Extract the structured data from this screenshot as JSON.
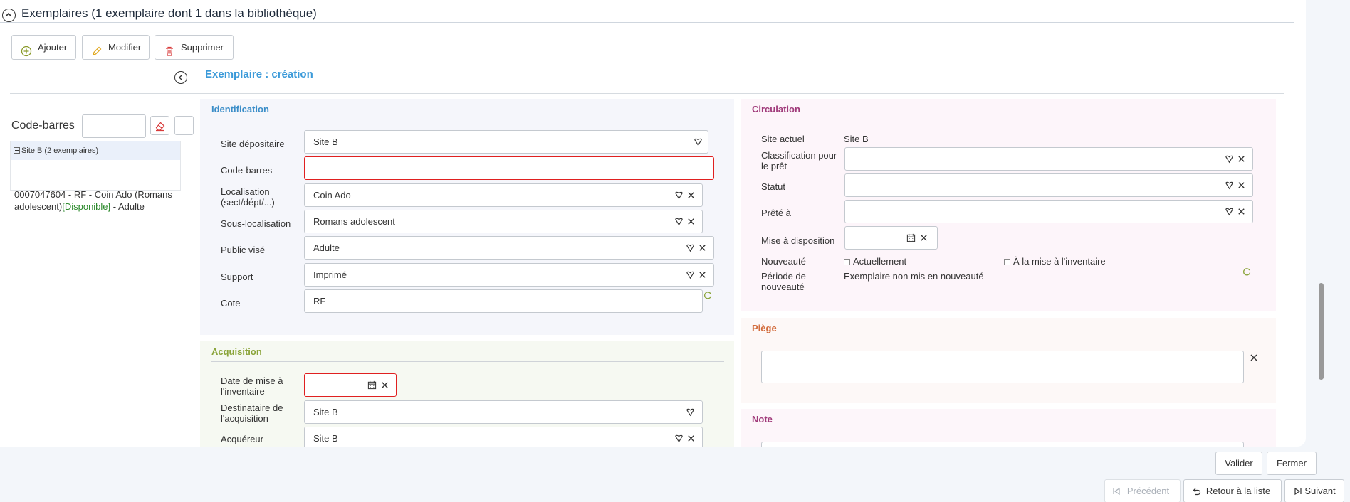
{
  "header": {
    "title": "Exemplaires (1 exemplaire dont 1 dans la bibliothèque)"
  },
  "toolbar": {
    "add": "Ajouter",
    "edit": "Modifier",
    "delete": "Supprimer"
  },
  "form": {
    "title": "Exemplaire : création"
  },
  "barcode_search": {
    "label": "Code-barres",
    "value": ""
  },
  "tree": {
    "node": "Site B (2 exemplaires)",
    "item_text": "0007047604 - RF - Coin Ado (Romans adolescent)",
    "item_status": "[Disponible]",
    "item_tail": " - Adulte"
  },
  "identification": {
    "title": "Identification",
    "fields": {
      "site": {
        "label": "Site dépositaire",
        "value": "Site B"
      },
      "barcode": {
        "label": "Code-barres",
        "value": ""
      },
      "location": {
        "label": "Localisation (sect/dépt/...)",
        "value": "Coin Ado"
      },
      "sublocation": {
        "label": "Sous-localisation",
        "value": "Romans adolescent"
      },
      "public": {
        "label": "Public visé",
        "value": "Adulte"
      },
      "support": {
        "label": "Support",
        "value": "Imprimé"
      },
      "cote": {
        "label": "Cote",
        "value": "RF"
      }
    }
  },
  "acquisition": {
    "title": "Acquisition",
    "fields": {
      "date": {
        "label": "Date de mise à l'inventaire",
        "value": ""
      },
      "recipient": {
        "label": "Destinataire de l'acquisition",
        "value": "Site B"
      },
      "buyer": {
        "label": "Acquéreur",
        "value": "Site B"
      }
    }
  },
  "circulation": {
    "title": "Circulation",
    "fields": {
      "current_site": {
        "label": "Site actuel",
        "value": "Site B"
      },
      "loan_class": {
        "label": "Classification pour le prêt",
        "value": ""
      },
      "status": {
        "label": "Statut",
        "value": ""
      },
      "lent_to": {
        "label": "Prêté à",
        "value": ""
      },
      "availability": {
        "label": "Mise à disposition",
        "value": ""
      },
      "novelty": {
        "label": "Nouveauté",
        "opt1": "Actuellement",
        "opt2": "À la mise à l'inventaire"
      },
      "novelty_period": {
        "label": "Période de nouveauté",
        "value": "Exemplaire non mis en nouveauté"
      }
    }
  },
  "piege": {
    "title": "Piège",
    "value": ""
  },
  "note": {
    "title": "Note"
  },
  "actions": {
    "validate": "Valider",
    "close": "Fermer"
  },
  "nav": {
    "prev": "Précédent",
    "back": "Retour à la liste",
    "next": "Suivant"
  },
  "colors": {
    "identification": "#3a8dc8",
    "acquisition": "#8aa43a",
    "circulation": "#a03a7a",
    "piege": "#d26a3a",
    "note": "#a03a7a",
    "error": "#e02020"
  }
}
